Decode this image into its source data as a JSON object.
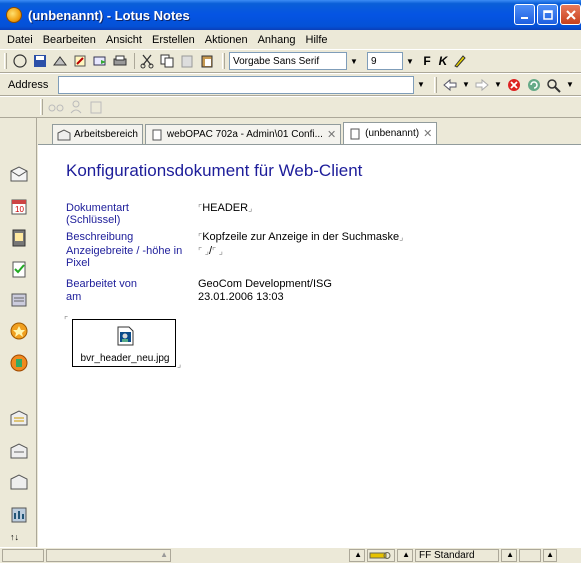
{
  "window": {
    "title": "(unbenannt) - Lotus Notes",
    "controls": [
      "minimize",
      "maximize",
      "close"
    ]
  },
  "menubar": {
    "items": [
      "Datei",
      "Bearbeiten",
      "Ansicht",
      "Erstellen",
      "Aktionen",
      "Anhang",
      "Hilfe"
    ]
  },
  "toolbar": {
    "font_name": "Vorgabe Sans Serif",
    "font_size": "9",
    "bold_label": "F",
    "italic_label": "K",
    "address_label": "Address"
  },
  "tabs": [
    {
      "label": "Arbeitsbereich",
      "active": false
    },
    {
      "label": "webOPAC 702a - Admin\\01 Confi...",
      "active": false
    },
    {
      "label": "(unbenannt)",
      "active": true
    }
  ],
  "document": {
    "title": "Konfigurationsdokument für Web-Client",
    "fields": [
      {
        "label_line1": "Dokumentart",
        "label_line2": "(Schlüssel)",
        "value": "HEADER"
      },
      {
        "label_line1": "Beschreibung",
        "label_line2": "",
        "value": "Kopfzeile zur Anzeige in der Suchmaske"
      },
      {
        "label_line1": "Anzeigebreite / -höhe in",
        "label_line2": "Pixel",
        "value": "/"
      },
      {
        "label_line1": "Bearbeitet von",
        "label_line2": "",
        "value": "GeoCom Development/ISG"
      },
      {
        "label_line1": "am",
        "label_line2": "",
        "value": "23.01.2006 13:03"
      }
    ],
    "attachment": "bvr_header_neu.jpg"
  },
  "statusbar": {
    "style": "FF Standard"
  },
  "colors": {
    "titlebar": "#0554e3",
    "label_blue": "#1d1d9a",
    "chrome": "#ece9d8"
  }
}
